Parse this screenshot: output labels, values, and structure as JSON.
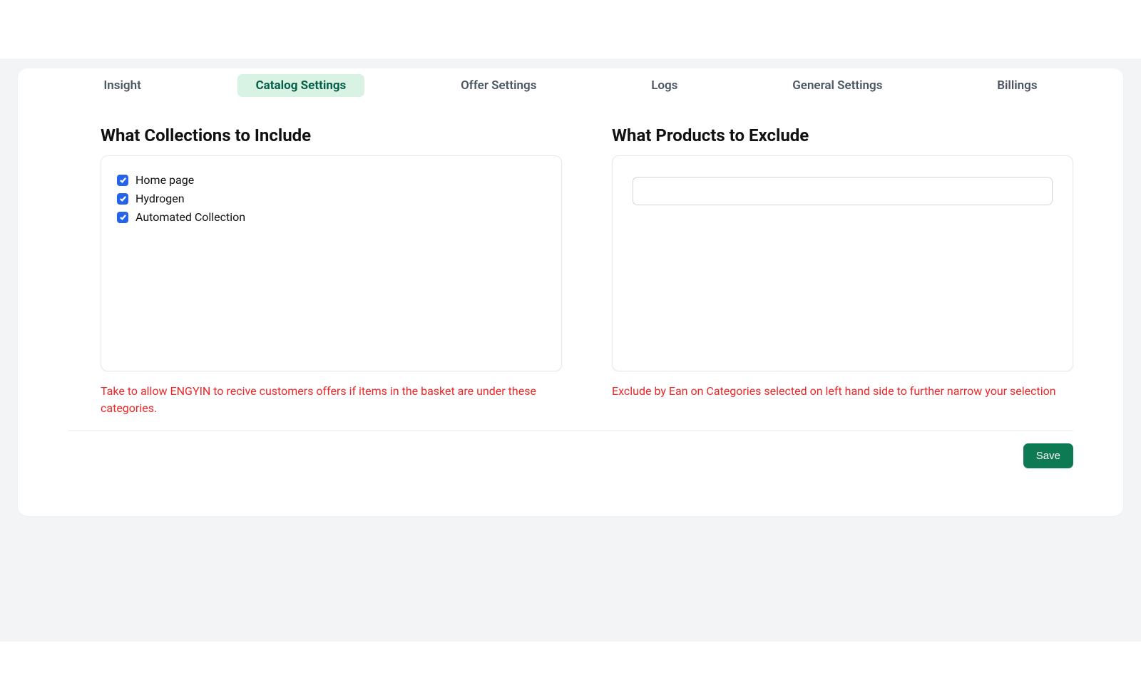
{
  "tabs": {
    "items": [
      {
        "label": "Insight",
        "active": false
      },
      {
        "label": "Catalog Settings",
        "active": true
      },
      {
        "label": "Offer Settings",
        "active": false
      },
      {
        "label": "Logs",
        "active": false
      },
      {
        "label": "General Settings",
        "active": false
      },
      {
        "label": "Billings",
        "active": false
      }
    ]
  },
  "include": {
    "title": "What Collections to Include",
    "items": [
      {
        "label": "Home page",
        "checked": true
      },
      {
        "label": "Hydrogen",
        "checked": true
      },
      {
        "label": "Automated Collection",
        "checked": true
      }
    ],
    "help": "Take to allow ENGYIN to recive customers offers if items in the basket are under these categories."
  },
  "exclude": {
    "title": "What Products to Exclude",
    "input_value": "",
    "input_placeholder": "",
    "help": "Exclude by Ean on Categories selected on left hand side to further narrow your selection"
  },
  "footer": {
    "save_label": "Save"
  },
  "colors": {
    "tab_active_bg": "#d8f2e3",
    "tab_active_fg": "#065f46",
    "checkbox_bg": "#2563eb",
    "help_text": "#ef2626",
    "save_bg": "#0d7a54"
  }
}
